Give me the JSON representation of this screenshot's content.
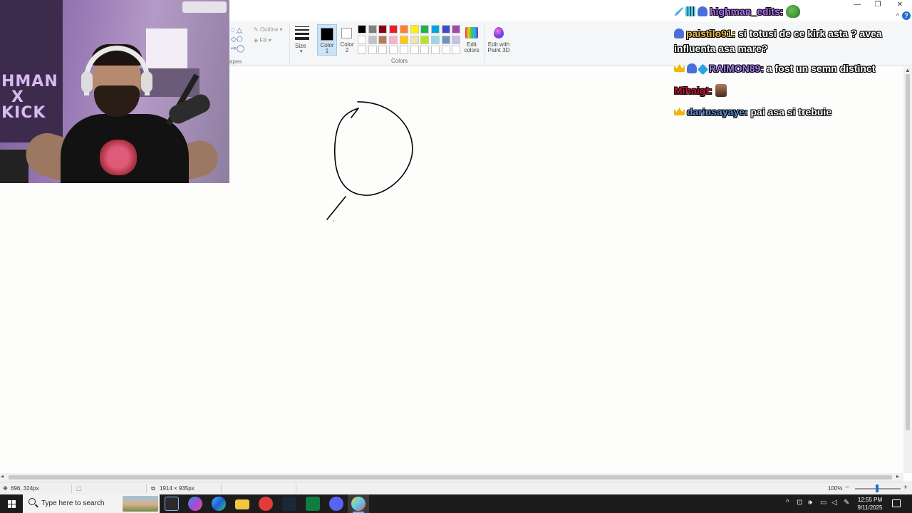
{
  "window_controls": {
    "minimize": "—",
    "restore": "❐",
    "close": "✕",
    "help": "?"
  },
  "ribbon": {
    "shapes": {
      "outline_label": "Outline",
      "fill_label": "Fill",
      "group_label": "apes"
    },
    "size_label": "Size",
    "color1_label": "Color 1",
    "color2_label": "Color 2",
    "colors_group_label": "Colors",
    "edit_colors_label": "Edit colors",
    "paint3d_label": "Edit with Paint 3D",
    "palette_row1": [
      "#000000",
      "#7f7f7f",
      "#880015",
      "#ed1c24",
      "#ff7f27",
      "#fff200",
      "#22b14c",
      "#00a2e8",
      "#3f48cc",
      "#a349a4"
    ],
    "palette_row2": [
      "#ffffff",
      "#c3c3c3",
      "#b97a57",
      "#ffaec9",
      "#ffc90e",
      "#efe4b0",
      "#b5e61d",
      "#99d9ea",
      "#7092be",
      "#c8bfe7"
    ],
    "palette_row3": [
      "#ffffff",
      "#ffffff",
      "#ffffff",
      "#ffffff",
      "#ffffff",
      "#ffffff",
      "#ffffff",
      "#ffffff",
      "#ffffff",
      "#ffffff"
    ]
  },
  "statusbar": {
    "cursor_pos": "696, 324px",
    "image_size": "1914 × 935px",
    "zoom": "100%",
    "zoom_out": "−",
    "zoom_in": "+"
  },
  "taskbar": {
    "search_placeholder": "Type here to search",
    "clock_time": "12:55 PM",
    "clock_date": "9/11/2025",
    "tray_chevron": "^"
  },
  "webcam": {
    "poster_text_line1": "HMAN",
    "poster_text_line2": "X",
    "poster_text_line3": "KICK"
  },
  "chat": {
    "messages": [
      {
        "user": "highman_edits:",
        "user_color": "#b36bff",
        "text": "",
        "badges": [
          "sword",
          "grid",
          "sub"
        ],
        "emote": "pepe"
      },
      {
        "user": "paistilo91:",
        "user_color": "#e8b84a",
        "text": "si totusi de ce kirk asta ? avea influenta asa mare?",
        "badges": [
          "sub"
        ]
      },
      {
        "user": "RAIMON89:",
        "user_color": "#a67cf0",
        "text": "a fost un semn distinct",
        "badges": [
          "crown",
          "sub",
          "box"
        ]
      },
      {
        "user": "Mihaigt:",
        "user_color": "#c8102e",
        "text": "",
        "badges": [],
        "emote": "face"
      },
      {
        "user": "dariusayaye:",
        "user_color": "#5d8fd8",
        "text": "pai asa si trebuie",
        "badges": [
          "crown"
        ]
      }
    ]
  },
  "colors": {
    "ribbon_bg": "#f5f6f7",
    "selected_blue": "#cce4f7",
    "taskbar_bg": "#1c1c1c",
    "canvas_bg": "#fdfdfc"
  }
}
